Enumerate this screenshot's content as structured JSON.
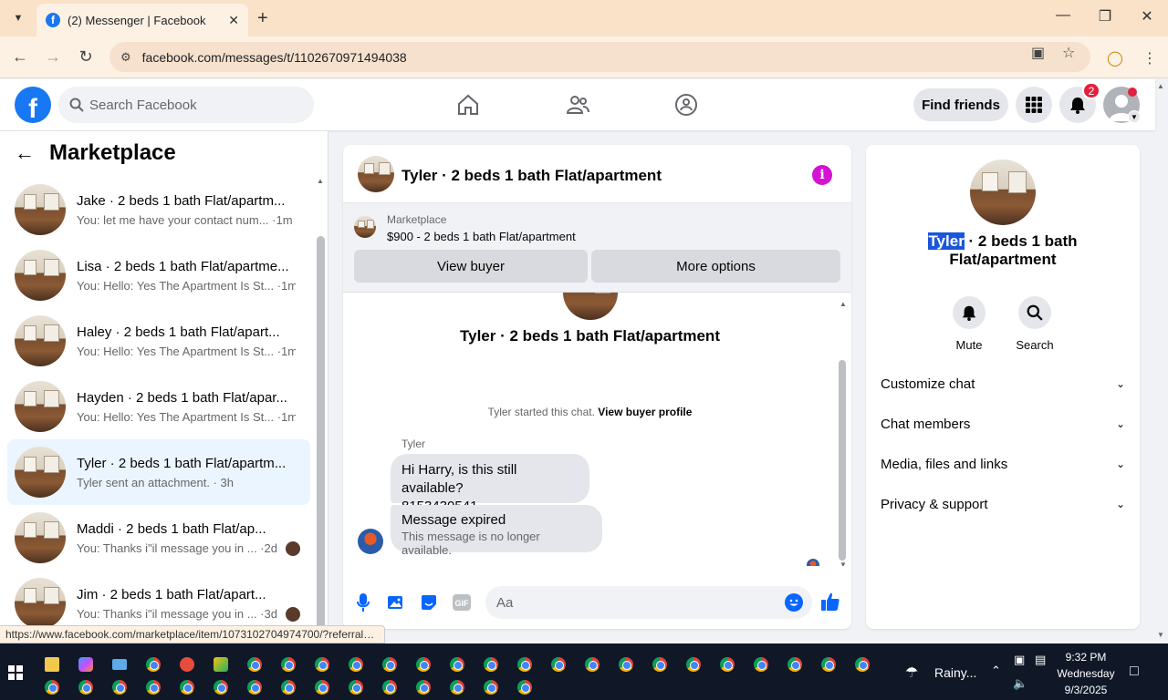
{
  "browser": {
    "tab_title": "(2) Messenger | Facebook",
    "url": "facebook.com/messages/t/1102670971494038",
    "status_url": "https://www.facebook.com/marketplace/item/1073102704974700/?referralS..."
  },
  "fb_header": {
    "search_placeholder": "Search Facebook",
    "find_friends": "Find friends",
    "notification_count": "2"
  },
  "left": {
    "title": "Marketplace",
    "conversations": [
      {
        "name": "Jake · 2 beds 1 bath Flat/apartm...",
        "preview": "You: let me have your contact num... ·1m"
      },
      {
        "name": "Lisa · 2 beds 1 bath Flat/apartme...",
        "preview": "You: Hello: Yes The Apartment Is St... ·1m"
      },
      {
        "name": "Haley · 2 beds 1 bath Flat/apart...",
        "preview": "You: Hello: Yes The Apartment Is St... ·1m"
      },
      {
        "name": "Hayden · 2 beds 1 bath Flat/apar...",
        "preview": "You: Hello: Yes The Apartment Is St... ·1m"
      },
      {
        "name": "Tyler · 2 beds 1 bath Flat/apartm...",
        "preview": "Tyler sent an attachment. · 3h"
      },
      {
        "name": "Maddi · 2 beds 1 bath Flat/ap...",
        "preview": "You: Thanks i\"il message you in ... ·2d"
      },
      {
        "name": "Jim · 2 beds 1 bath Flat/apart...",
        "preview": "You: Thanks i\"il message you in ... ·3d"
      }
    ]
  },
  "chat": {
    "title": "Tyler · 2 beds 1 bath Flat/apartment",
    "marketplace_label": "Marketplace",
    "listing": "$900 - 2 beds 1 bath Flat/apartment",
    "view_buyer": "View buyer",
    "more_options": "More options",
    "big_name": "Tyler · 2 beds 1 bath Flat/apartment",
    "started_text": "Tyler started this chat.",
    "view_buyer_profile": "View buyer profile",
    "sender": "Tyler",
    "message1_line1": "Hi Harry, is this still available?",
    "message1_line2": "8153430541",
    "message2_title": "Message expired",
    "message2_sub": "This message is no longer available.",
    "composer_placeholder": "Aa"
  },
  "right": {
    "name_highlight": "Tyler",
    "name_rest": " · 2 beds 1 bath Flat/apartment",
    "mute": "Mute",
    "search": "Search",
    "rows": [
      "Customize chat",
      "Chat members",
      "Media, files and links",
      "Privacy & support"
    ]
  },
  "taskbar": {
    "weather": "Rainy...",
    "time": "9:32 PM",
    "day": "Wednesday",
    "date": "9/3/2025"
  }
}
